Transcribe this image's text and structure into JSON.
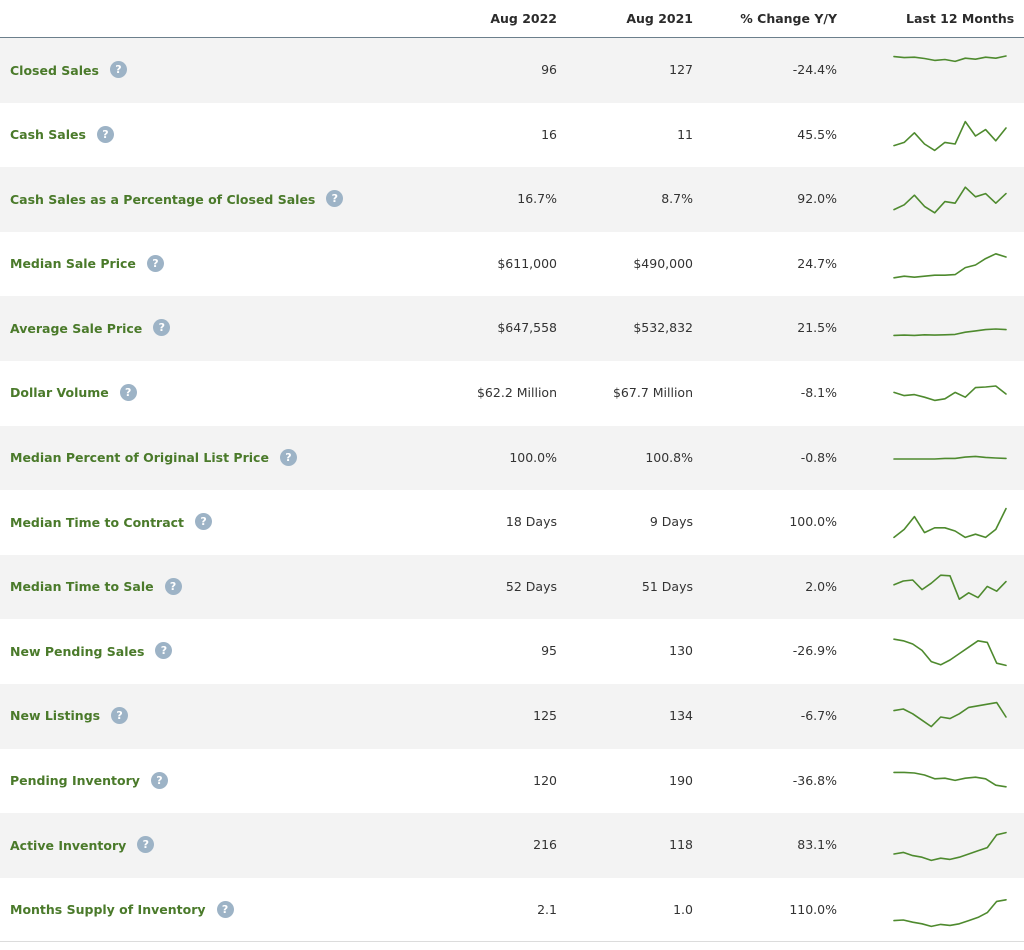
{
  "header": {
    "col1": "Aug 2022",
    "col2": "Aug 2021",
    "col3": "% Change Y/Y",
    "col4": "Last 12 Months"
  },
  "help_icon_glyph": "?",
  "accent_color": "#4e8a2e",
  "rows": [
    {
      "label": "Closed Sales",
      "aug2022": "96",
      "aug2021": "127",
      "change": "-24.4%",
      "trend": [
        0.95,
        0.92,
        0.93,
        0.89,
        0.83,
        0.86,
        0.8,
        0.9,
        0.87,
        0.93,
        0.9,
        0.97
      ]
    },
    {
      "label": "Cash Sales",
      "aug2022": "16",
      "aug2021": "11",
      "change": "45.5%",
      "trend": [
        0.2,
        0.3,
        0.6,
        0.25,
        0.05,
        0.3,
        0.25,
        0.95,
        0.5,
        0.7,
        0.35,
        0.75
      ]
    },
    {
      "label": "Cash Sales as a Percentage of Closed Sales",
      "aug2022": "16.7%",
      "aug2021": "8.7%",
      "change": "92.0%",
      "trend": [
        0.2,
        0.35,
        0.65,
        0.3,
        0.1,
        0.45,
        0.4,
        0.9,
        0.6,
        0.7,
        0.4,
        0.7
      ]
    },
    {
      "label": "Median Sale Price",
      "aug2022": "$611,000",
      "aug2021": "$490,000",
      "change": "24.7%",
      "trend": [
        0.1,
        0.15,
        0.12,
        0.15,
        0.18,
        0.18,
        0.2,
        0.42,
        0.5,
        0.7,
        0.85,
        0.75
      ]
    },
    {
      "label": "Average Sale Price",
      "aug2022": "$647,558",
      "aug2021": "$532,832",
      "change": "21.5%",
      "trend": [
        0.3,
        0.31,
        0.3,
        0.32,
        0.31,
        0.32,
        0.33,
        0.4,
        0.44,
        0.48,
        0.5,
        0.48
      ]
    },
    {
      "label": "Dollar Volume",
      "aug2022": "$62.2 Million",
      "aug2021": "$67.7 Million",
      "change": "-8.1%",
      "trend": [
        0.55,
        0.45,
        0.48,
        0.4,
        0.3,
        0.35,
        0.55,
        0.4,
        0.7,
        0.72,
        0.75,
        0.5
      ]
    },
    {
      "label": "Median Percent of Original List Price",
      "aug2022": "100.0%",
      "aug2021": "100.8%",
      "change": "-0.8%",
      "trend": [
        0.5,
        0.5,
        0.5,
        0.5,
        0.5,
        0.52,
        0.52,
        0.56,
        0.58,
        0.55,
        0.53,
        0.52
      ]
    },
    {
      "label": "Median Time to Contract",
      "aug2022": "18 Days",
      "aug2021": "9 Days",
      "change": "100.0%",
      "trend": [
        0.05,
        0.3,
        0.7,
        0.2,
        0.35,
        0.35,
        0.25,
        0.05,
        0.15,
        0.05,
        0.3,
        0.95
      ]
    },
    {
      "label": "Median Time to Sale",
      "aug2022": "52 Days",
      "aug2021": "51 Days",
      "change": "2.0%",
      "trend": [
        0.6,
        0.72,
        0.75,
        0.45,
        0.65,
        0.9,
        0.88,
        0.15,
        0.35,
        0.2,
        0.55,
        0.4,
        0.7
      ]
    },
    {
      "label": "New Pending Sales",
      "aug2022": "95",
      "aug2021": "130",
      "change": "-26.9%",
      "trend": [
        0.9,
        0.85,
        0.75,
        0.55,
        0.2,
        0.1,
        0.25,
        0.45,
        0.65,
        0.85,
        0.8,
        0.15,
        0.08
      ]
    },
    {
      "label": "New Listings",
      "aug2022": "125",
      "aug2021": "134",
      "change": "-6.7%",
      "trend": [
        0.7,
        0.75,
        0.6,
        0.4,
        0.2,
        0.5,
        0.45,
        0.6,
        0.8,
        0.85,
        0.9,
        0.95,
        0.5
      ]
    },
    {
      "label": "Pending Inventory",
      "aug2022": "120",
      "aug2021": "190",
      "change": "-36.8%",
      "trend": [
        0.8,
        0.8,
        0.78,
        0.72,
        0.6,
        0.62,
        0.55,
        0.62,
        0.65,
        0.6,
        0.4,
        0.35
      ]
    },
    {
      "label": "Active Inventory",
      "aug2022": "216",
      "aug2021": "118",
      "change": "83.1%",
      "trend": [
        0.25,
        0.3,
        0.2,
        0.15,
        0.05,
        0.12,
        0.08,
        0.15,
        0.25,
        0.35,
        0.45,
        0.85,
        0.92
      ]
    },
    {
      "label": "Months Supply of Inventory",
      "aug2022": "2.1",
      "aug2021": "1.0",
      "change": "110.0%",
      "trend": [
        0.2,
        0.22,
        0.15,
        0.1,
        0.02,
        0.08,
        0.05,
        0.1,
        0.2,
        0.3,
        0.45,
        0.8,
        0.85
      ]
    }
  ]
}
